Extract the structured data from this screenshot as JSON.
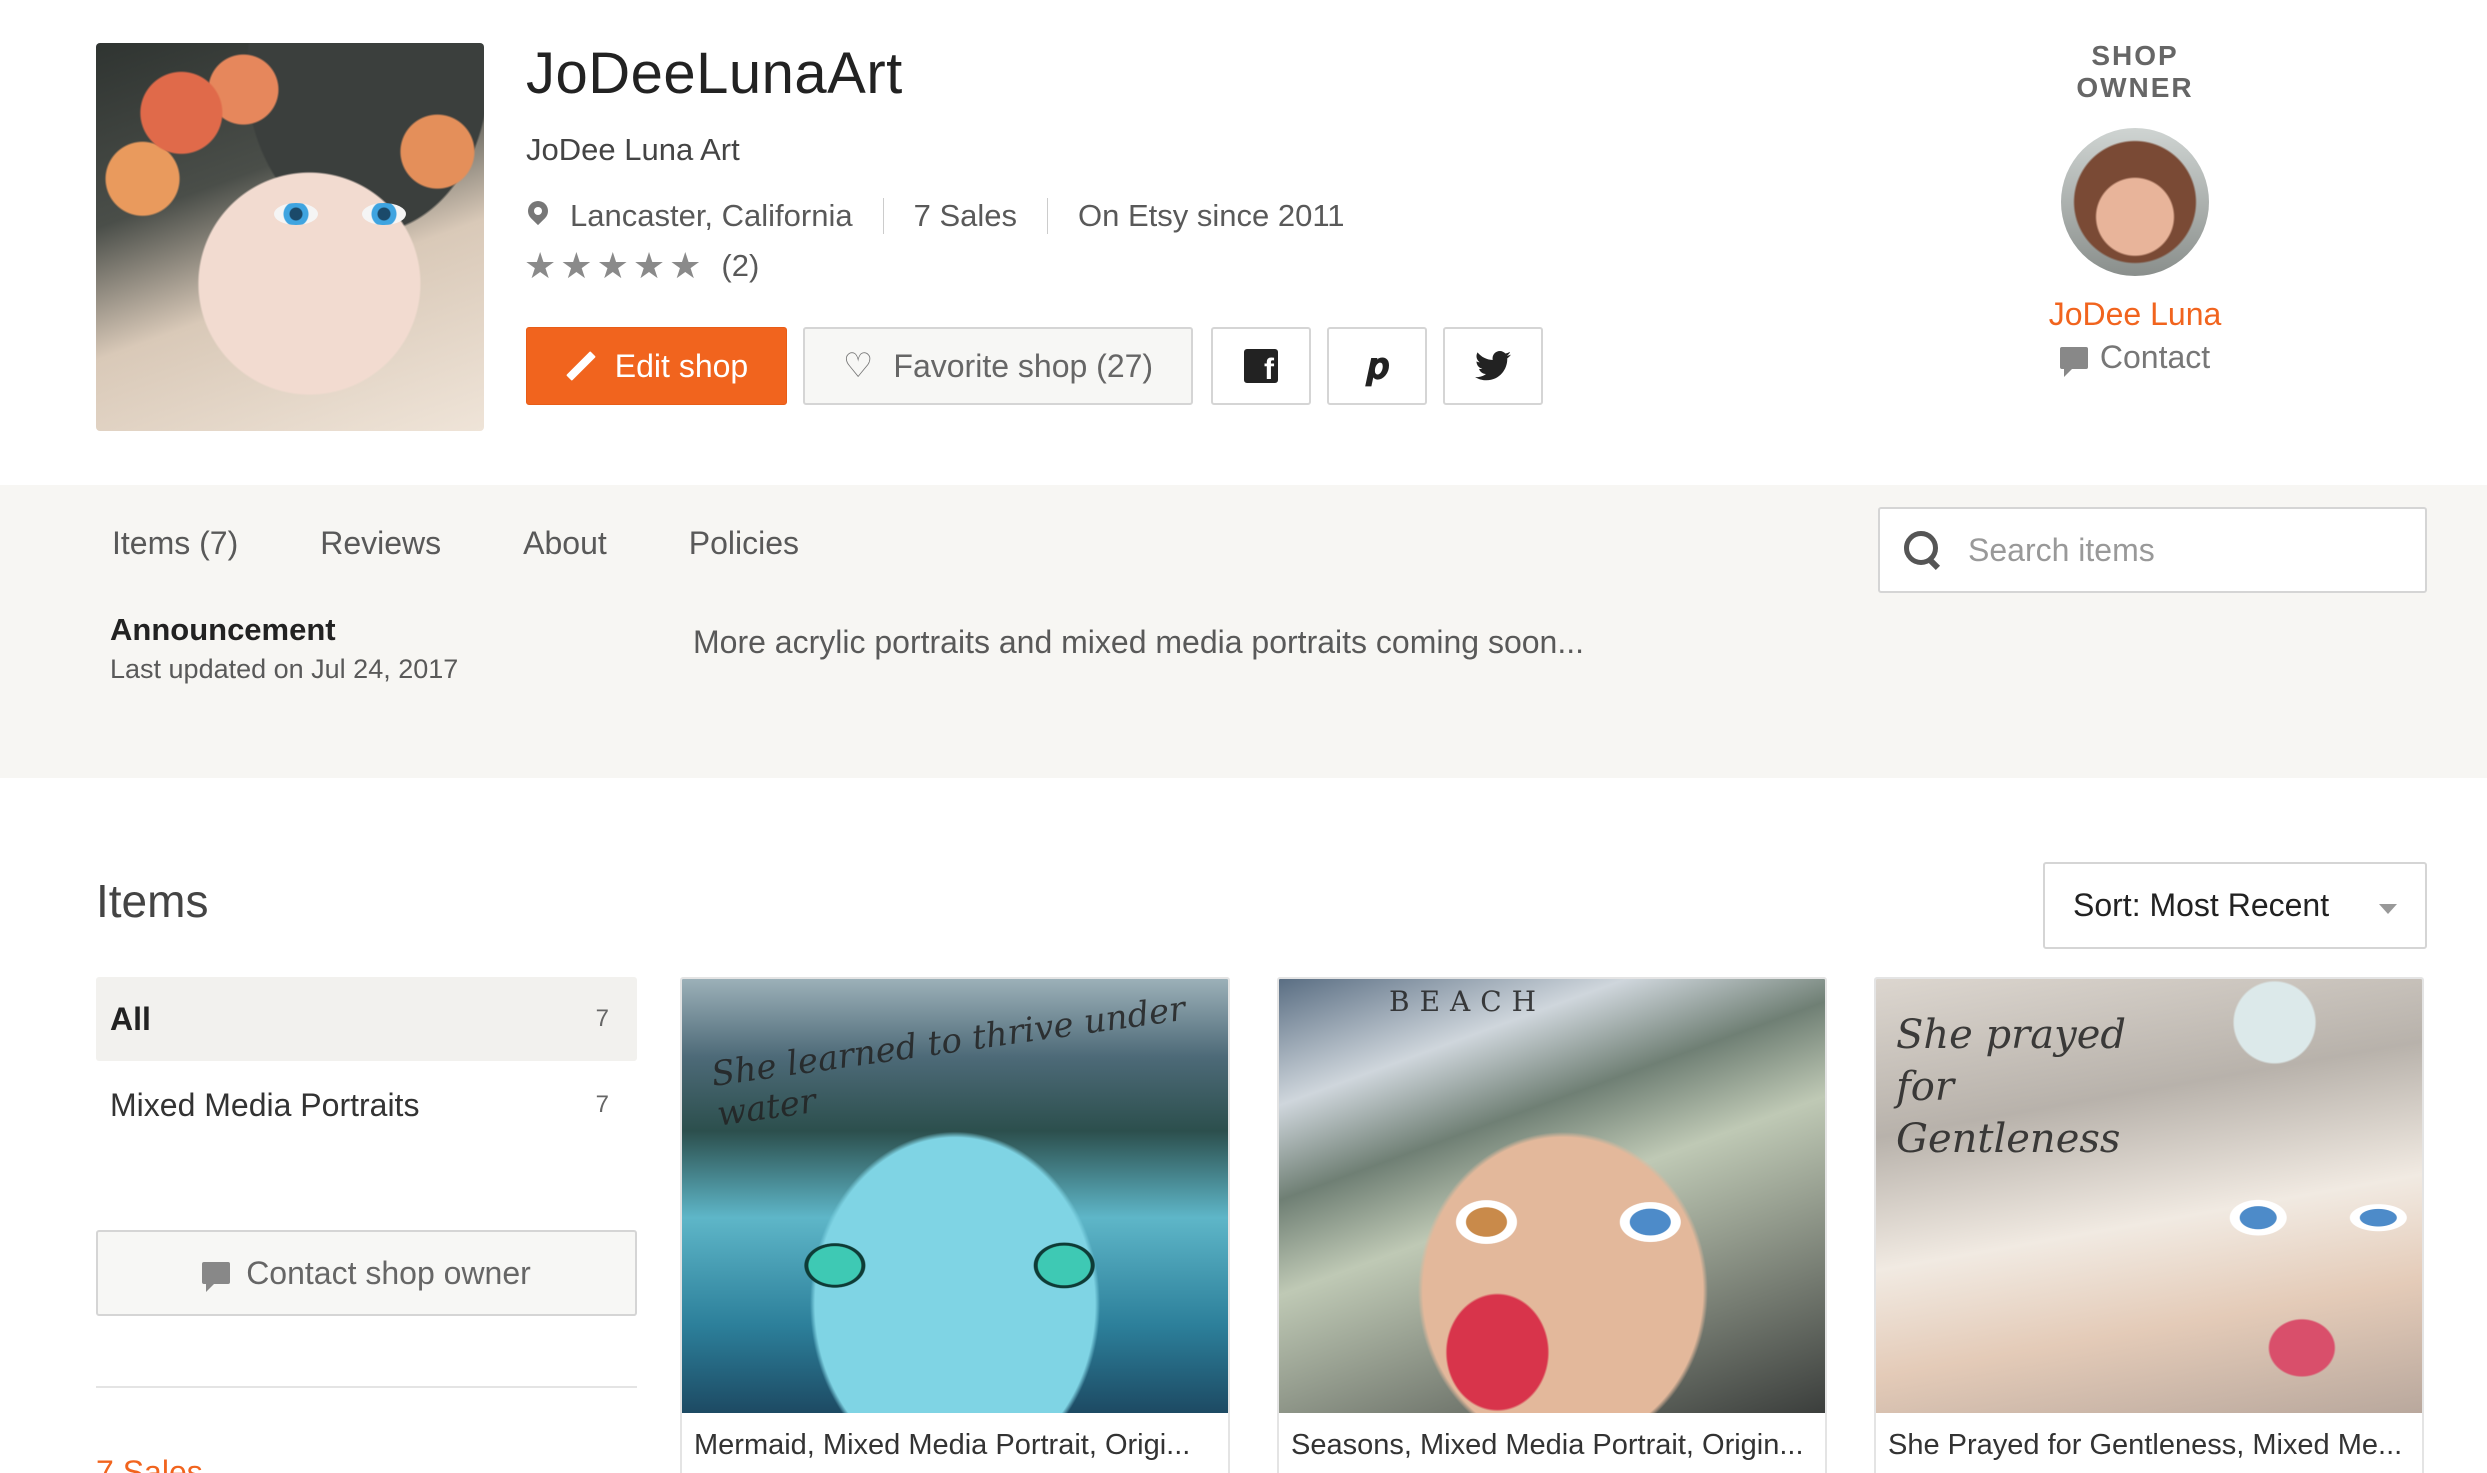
{
  "shop": {
    "name": "JoDeeLunaArt",
    "title": "JoDee Luna Art",
    "location": "Lancaster, California",
    "sales": "7 Sales",
    "since": "On Etsy since 2011",
    "rating_stars": 5,
    "review_count": "(2)"
  },
  "actions": {
    "edit_label": "Edit shop",
    "favorite_label": "Favorite shop (27)"
  },
  "owner": {
    "section_label": "SHOP OWNER",
    "name": "JoDee Luna",
    "contact_label": "Contact"
  },
  "tabs": [
    {
      "label": "Items (7)"
    },
    {
      "label": "Reviews"
    },
    {
      "label": "About"
    },
    {
      "label": "Policies"
    }
  ],
  "search": {
    "placeholder": "Search items"
  },
  "announcement": {
    "title": "Announcement",
    "date": "Last updated on Jul 24, 2017",
    "text": "More acrylic portraits and mixed media portraits coming soon..."
  },
  "items_section": {
    "heading": "Items",
    "sort_label": "Sort: Most Recent"
  },
  "categories": [
    {
      "label": "All",
      "count": "7"
    },
    {
      "label": "Mixed Media Portraits",
      "count": "7"
    }
  ],
  "sidebar": {
    "contact_button": "Contact shop owner",
    "sales_link": "7 Sales"
  },
  "listings": [
    {
      "title": "Mermaid, Mixed Media Portrait, Origi...",
      "art_text": "She learned to thrive under water"
    },
    {
      "title": "Seasons, Mixed Media Portrait, Origin...",
      "art_text": "BEACH"
    },
    {
      "title": "She Prayed for Gentleness, Mixed Me...",
      "art_text": "She prayed for Gentleness"
    }
  ],
  "colors": {
    "accent": "#f1641e",
    "band_bg": "#f7f6f3",
    "text_muted": "#595959"
  }
}
